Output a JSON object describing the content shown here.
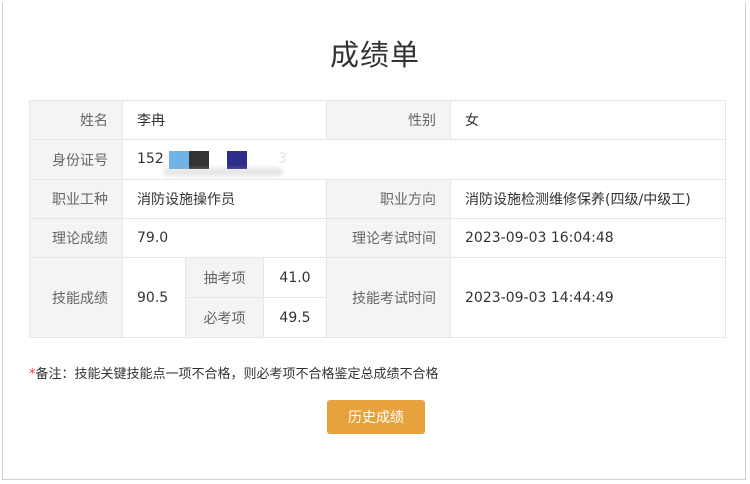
{
  "page": {
    "title": "成绩单"
  },
  "table": {
    "name_label": "姓名",
    "name_value": "李冉",
    "gender_label": "性别",
    "gender_value": "女",
    "id_label": "身份证号",
    "id_value_prefix": "152",
    "id_value_suffix": "3",
    "occupation_label": "职业工种",
    "occupation_value": "消防设施操作员",
    "direction_label": "职业方向",
    "direction_value": "消防设施检测维修保养(四级/中级工)",
    "theory_label": "理论成绩",
    "theory_value": "79.0",
    "theory_time_label": "理论考试时间",
    "theory_time_value": "2023-09-03 16:04:48",
    "skill_label": "技能成绩",
    "skill_value": "90.5",
    "sampling_label": "抽考项",
    "sampling_value": "41.0",
    "required_label": "必考项",
    "required_value": "49.5",
    "skill_time_label": "技能考试时间",
    "skill_time_value": "2023-09-03 14:44:49"
  },
  "note": {
    "star": "*",
    "text": "备注：技能关键技能点一项不合格，则必考项不合格鉴定总成绩不合格"
  },
  "buttons": {
    "history_label": "历史成绩"
  },
  "colors": {
    "accent_button": "#e6a23c",
    "skill_score": "#3b8fd6",
    "required_star": "#e0463a"
  }
}
